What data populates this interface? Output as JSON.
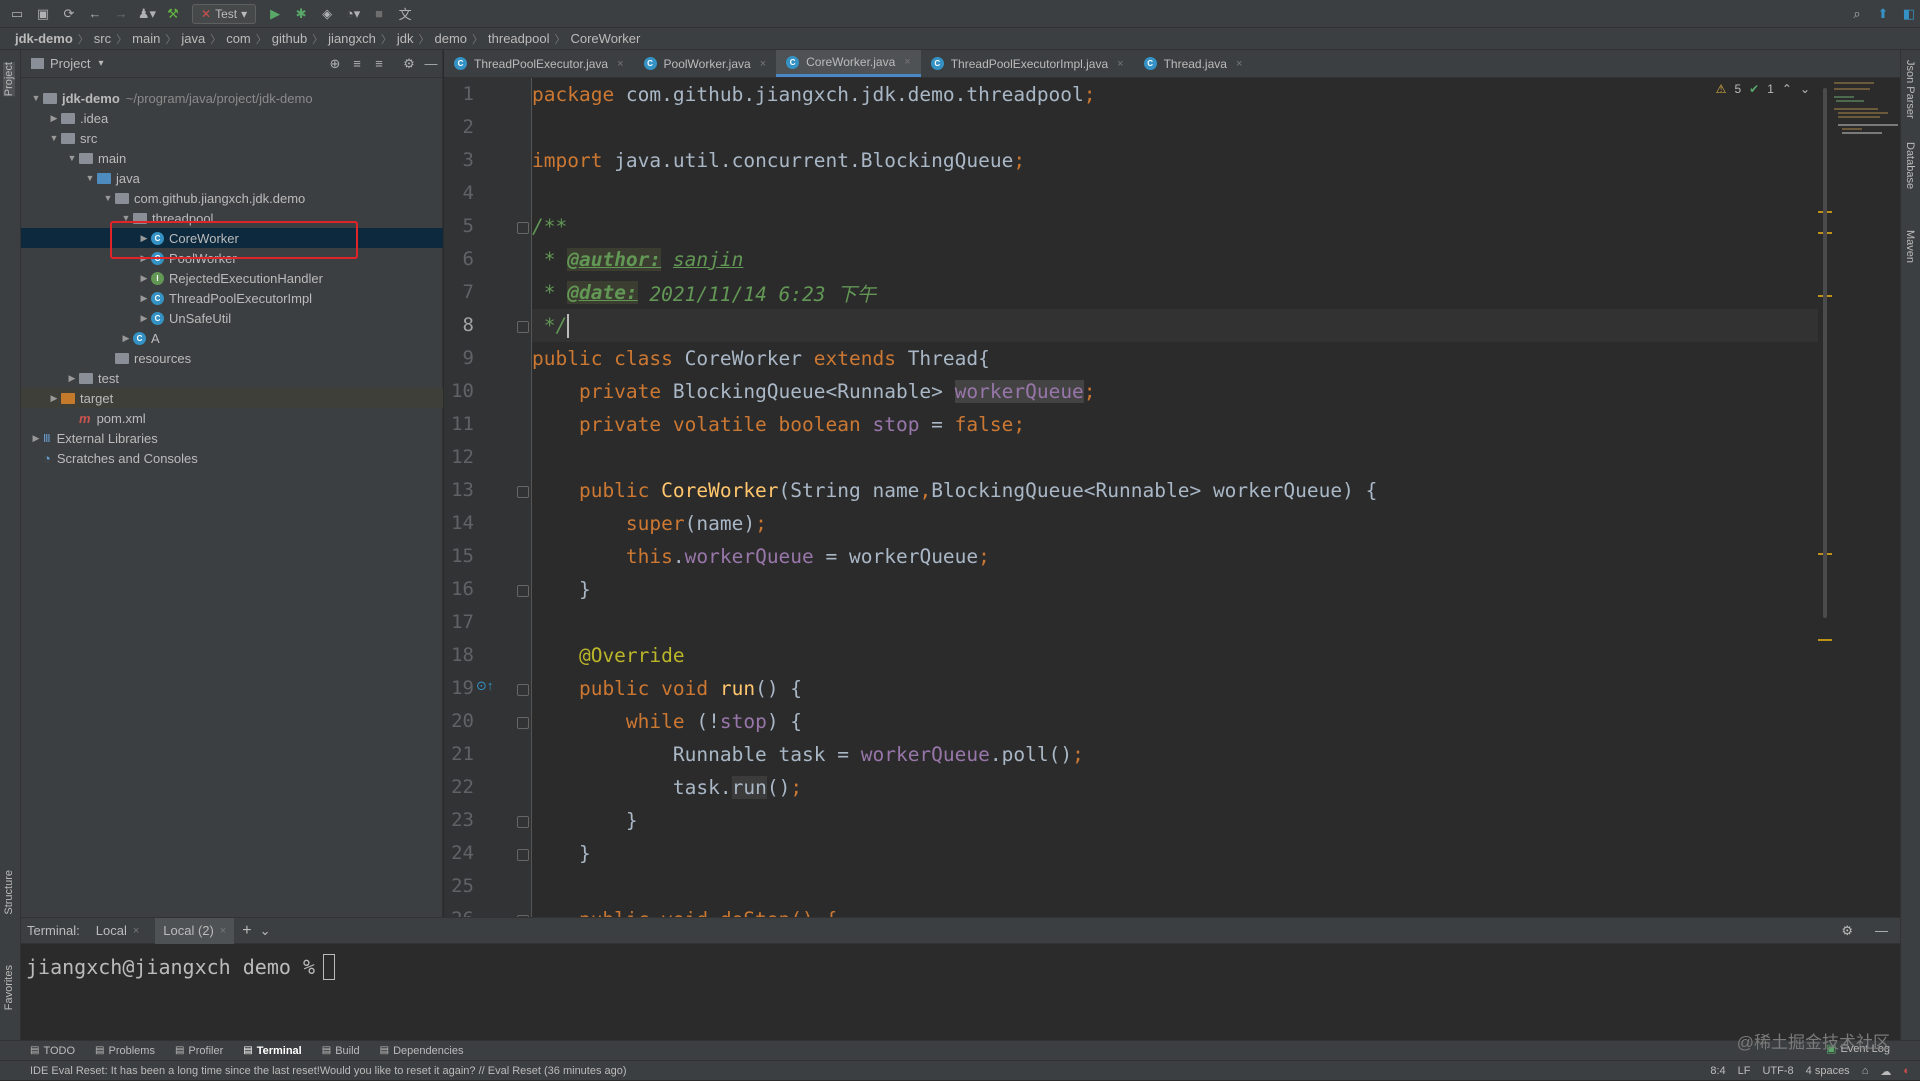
{
  "toolbar": {
    "run_config": "Test"
  },
  "breadcrumb": [
    "jdk-demo",
    "src",
    "main",
    "java",
    "com",
    "github",
    "jiangxch",
    "jdk",
    "demo",
    "threadpool",
    "CoreWorker"
  ],
  "left_strip": {
    "project": "Project",
    "structure": "Structure",
    "favorites": "Favorites"
  },
  "right_strip": {
    "json": "Json Parser",
    "database": "Database",
    "maven": "Maven"
  },
  "project": {
    "title": "Project",
    "tree": [
      {
        "label": "jdk-demo",
        "hint": "~/program/java/project/jdk-demo",
        "depth": 0,
        "icon": "folder",
        "arrow": "down"
      },
      {
        "label": ".idea",
        "depth": 1,
        "icon": "folder",
        "arrow": "right"
      },
      {
        "label": "src",
        "depth": 1,
        "icon": "folder",
        "arrow": "down"
      },
      {
        "label": "main",
        "depth": 2,
        "icon": "folder",
        "arrow": "down"
      },
      {
        "label": "java",
        "depth": 3,
        "icon": "folder-blue",
        "arrow": "down"
      },
      {
        "label": "com.github.jiangxch.jdk.demo",
        "depth": 4,
        "icon": "folder",
        "arrow": "down"
      },
      {
        "label": "threadpool",
        "depth": 5,
        "icon": "folder",
        "arrow": "down"
      },
      {
        "label": "CoreWorker",
        "depth": 6,
        "icon": "class",
        "arrow": "right",
        "selected": true
      },
      {
        "label": "PoolWorker",
        "depth": 6,
        "icon": "class",
        "arrow": "right"
      },
      {
        "label": "RejectedExecutionHandler",
        "depth": 6,
        "icon": "interface",
        "arrow": "right"
      },
      {
        "label": "ThreadPoolExecutorImpl",
        "depth": 6,
        "icon": "class",
        "arrow": "right"
      },
      {
        "label": "UnSafeUtil",
        "depth": 6,
        "icon": "class",
        "arrow": "right"
      },
      {
        "label": "A",
        "depth": 5,
        "icon": "class",
        "arrow": "right"
      },
      {
        "label": "resources",
        "depth": 4,
        "icon": "folder",
        "arrow": ""
      },
      {
        "label": "test",
        "depth": 2,
        "icon": "folder",
        "arrow": "right"
      },
      {
        "label": "target",
        "depth": 1,
        "icon": "folder-orange",
        "arrow": "right",
        "highlighted": true
      },
      {
        "label": "pom.xml",
        "depth": 2,
        "icon": "maven",
        "arrow": ""
      },
      {
        "label": "External Libraries",
        "depth": 0,
        "icon": "library",
        "arrow": "right"
      },
      {
        "label": "Scratches and Consoles",
        "depth": 0,
        "icon": "scratch",
        "arrow": ""
      }
    ]
  },
  "tabs": [
    {
      "label": "ThreadPoolExecutor.java",
      "active": false
    },
    {
      "label": "PoolWorker.java",
      "active": false
    },
    {
      "label": "CoreWorker.java",
      "active": true
    },
    {
      "label": "ThreadPoolExecutorImpl.java",
      "active": false
    },
    {
      "label": "Thread.java",
      "active": false
    }
  ],
  "inspections": {
    "warnings": "5",
    "checks": "1"
  },
  "editor": {
    "current_line": 8,
    "lines": [
      [
        {
          "t": "package ",
          "c": "kw"
        },
        {
          "t": "com.github.jiangxch.jdk.demo.threadpool",
          "c": ""
        },
        {
          "t": ";",
          "c": "kw"
        }
      ],
      [],
      [
        {
          "t": "import ",
          "c": "kw"
        },
        {
          "t": "java.util.concurrent.BlockingQueue",
          "c": ""
        },
        {
          "t": ";",
          "c": "kw"
        }
      ],
      [],
      [
        {
          "t": "/**",
          "c": "cm"
        }
      ],
      [
        {
          "t": " * ",
          "c": "cm"
        },
        {
          "t": "@author:",
          "c": "tag"
        },
        {
          "t": " ",
          "c": "cm"
        },
        {
          "t": "sanjin",
          "c": "cm-u"
        }
      ],
      [
        {
          "t": " * ",
          "c": "cm"
        },
        {
          "t": "@date:",
          "c": "tag"
        },
        {
          "t": " 2021/11/14 6:23 下午",
          "c": "cm"
        }
      ],
      [
        {
          "t": " */",
          "c": "cm"
        },
        {
          "t": "",
          "c": "cursor"
        }
      ],
      [
        {
          "t": "public class ",
          "c": "kw"
        },
        {
          "t": "CoreWorker ",
          "c": ""
        },
        {
          "t": "extends ",
          "c": "kw"
        },
        {
          "t": "Thread{",
          "c": ""
        }
      ],
      [
        {
          "t": "    private ",
          "c": "kw"
        },
        {
          "t": "BlockingQueue<Runnable> ",
          "c": ""
        },
        {
          "t": "workerQueue",
          "c": "fld-hl"
        },
        {
          "t": ";",
          "c": "kw"
        }
      ],
      [
        {
          "t": "    private volatile boolean ",
          "c": "kw"
        },
        {
          "t": "stop ",
          "c": "fld"
        },
        {
          "t": "= ",
          "c": ""
        },
        {
          "t": "false;",
          "c": "kw"
        }
      ],
      [],
      [
        {
          "t": "    public ",
          "c": "kw"
        },
        {
          "t": "CoreWorker",
          "c": "fn"
        },
        {
          "t": "(String name",
          "c": ""
        },
        {
          "t": ",",
          "c": "kw"
        },
        {
          "t": "BlockingQueue<Runnable> workerQueue) {",
          "c": ""
        }
      ],
      [
        {
          "t": "        super",
          "c": "kw"
        },
        {
          "t": "(name)",
          "c": ""
        },
        {
          "t": ";",
          "c": "kw"
        }
      ],
      [
        {
          "t": "        this",
          "c": "kw"
        },
        {
          "t": ".",
          "c": ""
        },
        {
          "t": "workerQueue ",
          "c": "fld"
        },
        {
          "t": "= workerQueue",
          "c": ""
        },
        {
          "t": ";",
          "c": "kw"
        }
      ],
      [
        {
          "t": "    }",
          "c": ""
        }
      ],
      [],
      [
        {
          "t": "    @Override",
          "c": "ann"
        }
      ],
      [
        {
          "t": "    public void ",
          "c": "kw"
        },
        {
          "t": "run",
          "c": "fn"
        },
        {
          "t": "() {",
          "c": ""
        }
      ],
      [
        {
          "t": "        while ",
          "c": "kw"
        },
        {
          "t": "(!",
          "c": ""
        },
        {
          "t": "stop",
          "c": "fld"
        },
        {
          "t": ") {",
          "c": ""
        }
      ],
      [
        {
          "t": "            Runnable task = ",
          "c": ""
        },
        {
          "t": "workerQueue",
          "c": "fld"
        },
        {
          "t": ".poll()",
          "c": ""
        },
        {
          "t": ";",
          "c": "kw"
        }
      ],
      [
        {
          "t": "            task.",
          "c": ""
        },
        {
          "t": "run",
          "c": "hl"
        },
        {
          "t": "()",
          "c": ""
        },
        {
          "t": ";",
          "c": "kw"
        }
      ],
      [
        {
          "t": "        }",
          "c": ""
        }
      ],
      [
        {
          "t": "    }",
          "c": ""
        }
      ],
      [],
      [
        {
          "t": "    public void doStop() {",
          "c": "kw"
        }
      ]
    ]
  },
  "terminal": {
    "label": "Terminal:",
    "tabs": [
      "Local",
      "Local (2)"
    ],
    "prompt": "jiangxch@jiangxch demo % "
  },
  "bottom_tabs": [
    "TODO",
    "Problems",
    "Profiler",
    "Terminal",
    "Build",
    "Dependencies"
  ],
  "bottom_active": "Terminal",
  "event_log": "Event Log",
  "status": {
    "message": "IDE Eval Reset: It has been a long time since the last reset!Would you like to reset it again? // Eval Reset (36 minutes ago)",
    "position": "8:4",
    "line_sep": "LF",
    "encoding": "UTF-8",
    "indent": "4 spaces"
  },
  "watermark": "@稀土掘金技术社区"
}
